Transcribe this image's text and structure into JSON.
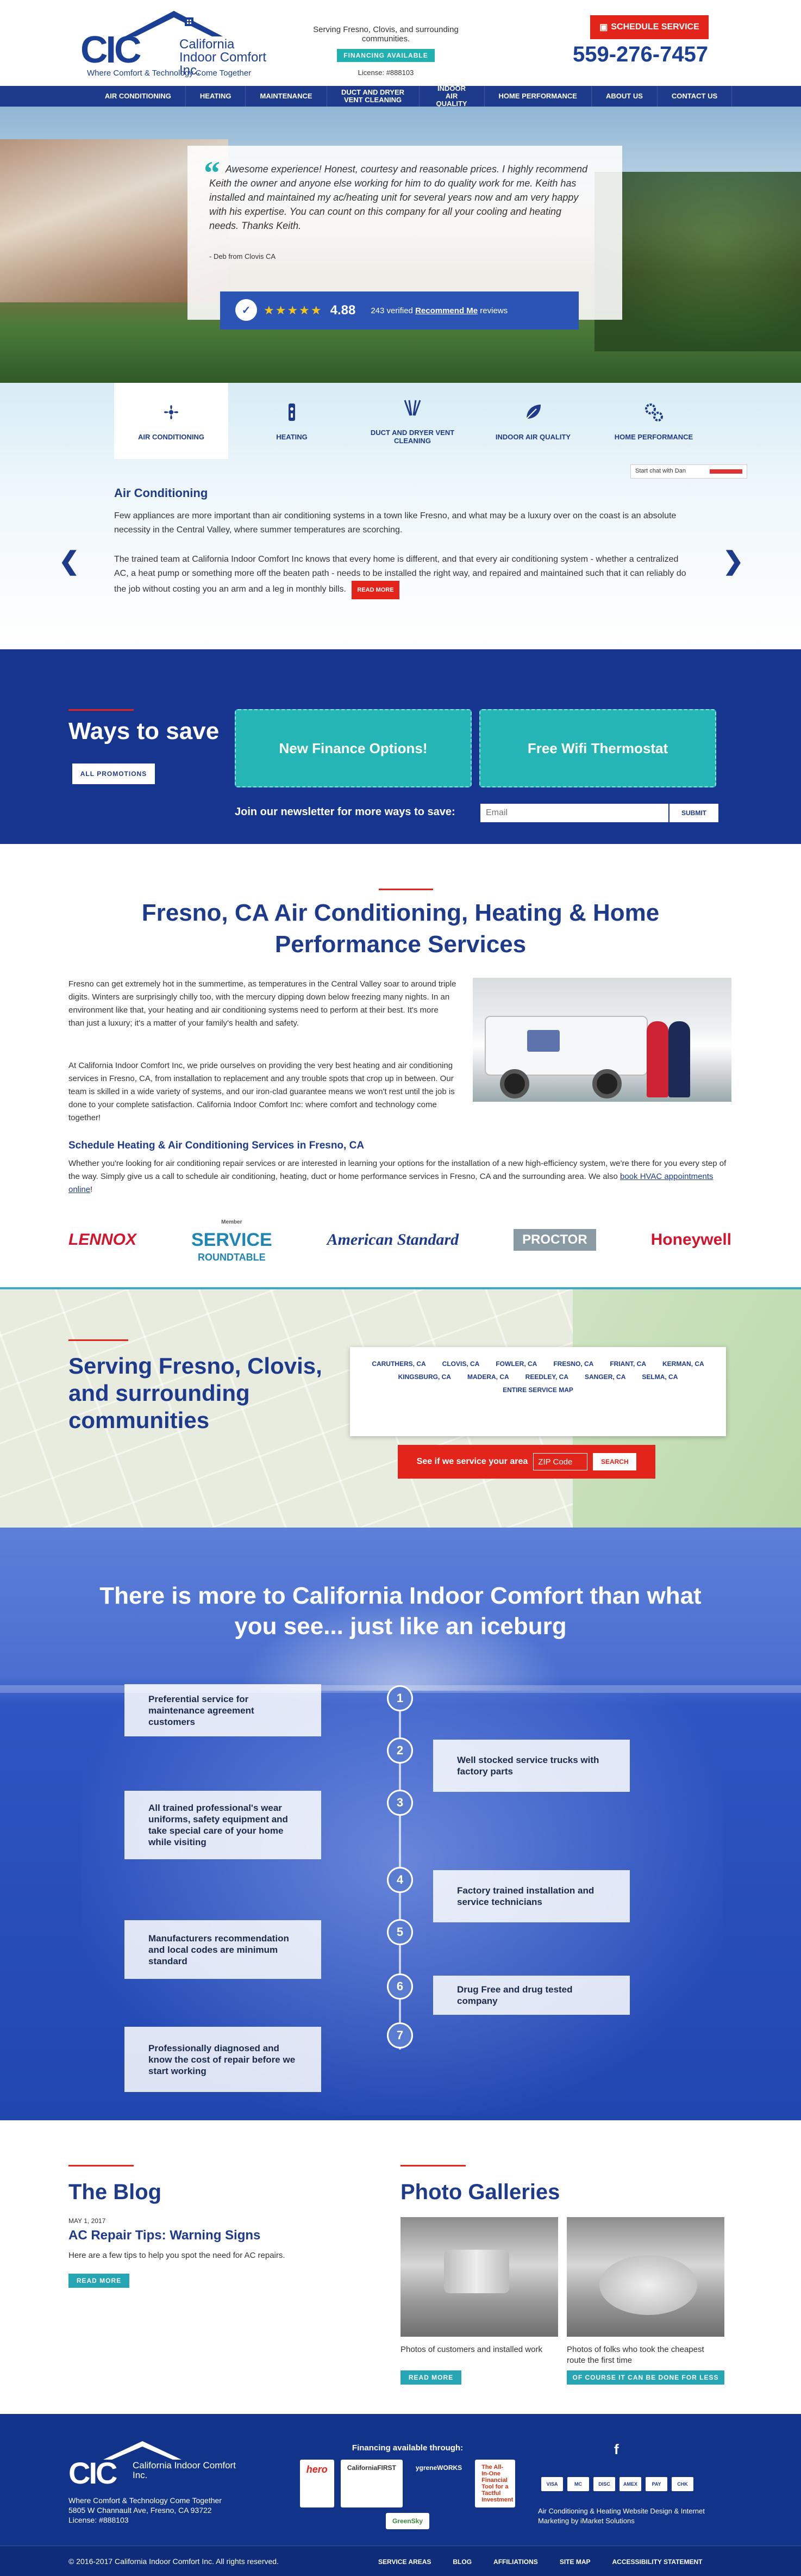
{
  "header": {
    "logo_letters": "CIC",
    "logo_name": "California Indoor Comfort Inc.",
    "logo_tagline": "Where Comfort & Technology Come Together",
    "service_area": "Serving Fresno, Clovis, and surrounding communities.",
    "financing_badge": "FINANCING AVAILABLE",
    "license": "License: #888103",
    "schedule_button": "SCHEDULE SERVICE",
    "phone": "559-276-7457"
  },
  "nav": [
    "AIR CONDITIONING",
    "HEATING",
    "MAINTENANCE",
    "DUCT AND DRYER VENT CLEANING",
    "INDOOR AIR QUALITY",
    "HOME PERFORMANCE",
    "ABOUT US",
    "CONTACT US"
  ],
  "hero": {
    "quote": "Awesome experience! Honest, courtesy and reasonable prices. I highly recommend Keith the owner and anyone else working for him to do quality work for me. Keith has installed and maintained my ac/heating unit for several years now and am very happy with his expertise. You can count on this company for all your cooling and heating needs. Thanks Keith.",
    "author": "- Deb from Clovis CA",
    "stars": "★★★★★",
    "rating": "4.88",
    "reviews_pre": "243 verified",
    "reviews_link": "Recommend Me",
    "reviews_post": "reviews"
  },
  "services": {
    "tabs": [
      {
        "label": "AIR CONDITIONING",
        "icon": "fan-icon"
      },
      {
        "label": "HEATING",
        "icon": "thermostat-icon"
      },
      {
        "label": "DUCT AND DRYER VENT CLEANING",
        "icon": "vent-icon"
      },
      {
        "label": "INDOOR AIR QUALITY",
        "icon": "leaf-icon"
      },
      {
        "label": "HOME PERFORMANCE",
        "icon": "gears-icon"
      }
    ],
    "chat_label": "Start chat with Dan",
    "title": "Air Conditioning",
    "p1": "Few appliances are more important than air conditioning systems in a town like Fresno, and what may be a luxury over on the coast is an absolute necessity in the Central Valley, where summer temperatures are scorching.",
    "p2": "The trained team at California Indoor Comfort Inc knows that every home is different, and that every air conditioning system - whether a centralized AC, a heat pump or something more off the beaten path - needs to be installed the right way, and repaired and maintained such that it can reliably do the job without costing you an arm and a leg in monthly bills.",
    "read_more": "READ MORE",
    "prev": "❮",
    "next": "❯"
  },
  "save": {
    "title": "Ways to save",
    "all_promotions": "ALL PROMOTIONS",
    "promo1": "New Finance Options!",
    "promo2": "Free Wifi Thermostat",
    "newsletter": "Join our newsletter for more ways to save:",
    "email_placeholder": "Email",
    "submit": "SUBMIT"
  },
  "content": {
    "title": "Fresno, CA Air Conditioning, Heating & Home Performance Services",
    "p1": "Fresno can get extremely hot in the summertime, as temperatures in the Central Valley soar to around triple digits. Winters are surprisingly chilly too, with the mercury dipping down below freezing many nights. In an environment like that, your heating and air conditioning systems need to perform at their best. It's more than just a luxury; it's a matter of your family's health and safety.",
    "p2": "At California Indoor Comfort Inc, we pride ourselves on providing the very best heating and air conditioning services in Fresno, CA, from installation to replacement and any trouble spots that crop up in between. Our team is skilled in a wide variety of systems, and our iron-clad guarantee means we won't rest until the job is done to your complete satisfaction. California Indoor Comfort Inc: where comfort and technology come together!",
    "h3": "Schedule Heating & Air Conditioning Services in Fresno, CA",
    "p3": "Whether you're looking for air conditioning repair services or are interested in learning your options for the installation of a new high-efficiency system, we're there for you every step of the way. Simply give us a call to schedule air conditioning, heating, duct or home performance services in Fresno, CA and the surrounding area. We also",
    "p3_link": "book HVAC appointments online",
    "p3_end": "!",
    "brands": {
      "lennox": "LENNOX",
      "src_member": "Member",
      "src": "SERVICE",
      "src2": "ROUNDTABLE",
      "amstd": "American Standard",
      "proctor": "PROCTOR",
      "hw": "Honeywell"
    }
  },
  "area": {
    "title": "Serving Fresno, Clovis, and surrounding communities",
    "cities": [
      "CARUTHERS, CA",
      "CLOVIS, CA",
      "FOWLER, CA",
      "FRESNO, CA",
      "FRIANT, CA",
      "KERMAN, CA",
      "KINGSBURG, CA",
      "MADERA, CA",
      "REEDLEY, CA",
      "SANGER, CA",
      "SELMA, CA",
      "ENTIRE SERVICE MAP"
    ],
    "zip_label": "See if we service your area",
    "zip_placeholder": "ZIP Code",
    "zip_button": "SEARCH"
  },
  "iceberg": {
    "title": "There is more to California Indoor Comfort than what you see... just like an iceburg",
    "facts": [
      {
        "n": "1",
        "text": "Preferential service for maintenance agreement customers"
      },
      {
        "n": "2",
        "text": "Well stocked service trucks with factory parts"
      },
      {
        "n": "3",
        "text": "All trained professional's wear uniforms, safety equipment and take special care of your home while visiting"
      },
      {
        "n": "4",
        "text": "Factory trained installation and service technicians"
      },
      {
        "n": "5",
        "text": "Manufacturers recommendation and local codes are minimum standard"
      },
      {
        "n": "6",
        "text": "Drug Free and drug tested company"
      },
      {
        "n": "7",
        "text": "Professionally diagnosed and know the cost of repair before we start working"
      }
    ]
  },
  "blog": {
    "title": "The Blog",
    "date": "MAY 1, 2017",
    "post_title": "AC Repair Tips: Warning Signs",
    "excerpt": "Here are a few tips to help you spot the need for AC repairs.",
    "read_more": "READ MORE"
  },
  "gallery": {
    "title": "Photo Galleries",
    "cap1": "Photos of customers and installed work",
    "cap2": "Photos of folks who took the cheapest route the first time",
    "btn1": "READ MORE",
    "btn2": "OF COURSE IT CAN BE DONE FOR LESS"
  },
  "footer": {
    "logo_letters": "CIC",
    "logo_name": "California Indoor Comfort Inc.",
    "tagline": "Where Comfort & Technology Come Together",
    "address": "5805 W Channault Ave, Fresno, CA 93722",
    "license": "License: #888103",
    "financing_title": "Financing available through:",
    "fin_logos": [
      "hero",
      "CaliforniaFIRST",
      "ygreneWORKS",
      "The All-In-One Financial Tool for a Tactful Investment",
      "GreenSky"
    ],
    "facebook": "f",
    "cards": [
      "VISA",
      "MC",
      "DISC",
      "AMEX",
      "PAY",
      "CHK"
    ],
    "credit": "Air Conditioning & Heating Website Design & Internet Marketing by iMarket Solutions",
    "copyright": "© 2016-2017 California Indoor Comfort Inc. All rights reserved.",
    "links": [
      "SERVICE AREAS",
      "BLOG",
      "AFFILIATIONS",
      "SITE MAP",
      "ACCESSIBILITY STATEMENT"
    ]
  }
}
